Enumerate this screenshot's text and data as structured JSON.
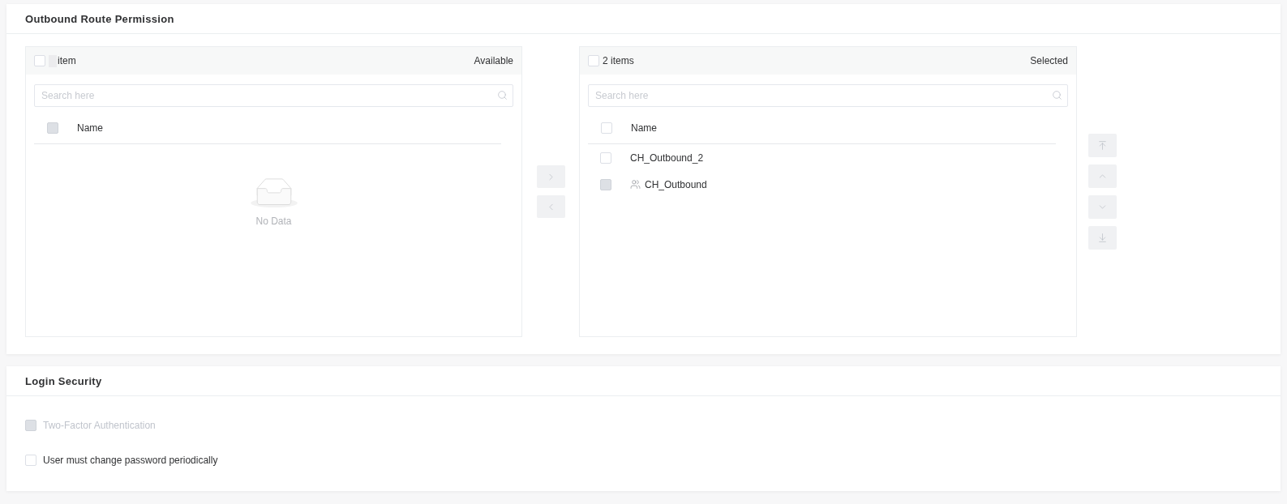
{
  "outbound_route_permission": {
    "title": "Outbound Route Permission",
    "available_list": {
      "select_all": {
        "checked": false,
        "disabled": false
      },
      "count_masked": true,
      "count_label": "item",
      "title": "Available",
      "search": {
        "placeholder": "Search here"
      },
      "column_header": {
        "label": "Name",
        "checked": false,
        "disabled": true
      },
      "empty_text": "No Data"
    },
    "move_buttons": [
      {
        "kind": "right",
        "disabled": true
      },
      {
        "kind": "left",
        "disabled": true
      }
    ],
    "selected_list": {
      "select_all": {
        "checked": false,
        "disabled": false
      },
      "count_label": "2 items",
      "title": "Selected",
      "search": {
        "placeholder": "Search here"
      },
      "column_header": {
        "label": "Name",
        "checked": false,
        "disabled": false
      },
      "rows": [
        {
          "kind": "plain",
          "name": "CH_Outbound_2",
          "checked": false,
          "disabled": false
        },
        {
          "kind": "group",
          "name": "CH_Outbound",
          "checked": false,
          "disabled": true
        }
      ]
    },
    "order_buttons": [
      {
        "kind": "top",
        "disabled": true
      },
      {
        "kind": "up",
        "disabled": true
      },
      {
        "kind": "down",
        "disabled": true
      },
      {
        "kind": "bottom",
        "disabled": true
      }
    ]
  },
  "login_security": {
    "title": "Login Security",
    "options": [
      {
        "label": "Two-Factor Authentication",
        "checked": false,
        "disabled": true
      },
      {
        "label": "User must change password periodically",
        "checked": false,
        "disabled": false
      }
    ]
  }
}
